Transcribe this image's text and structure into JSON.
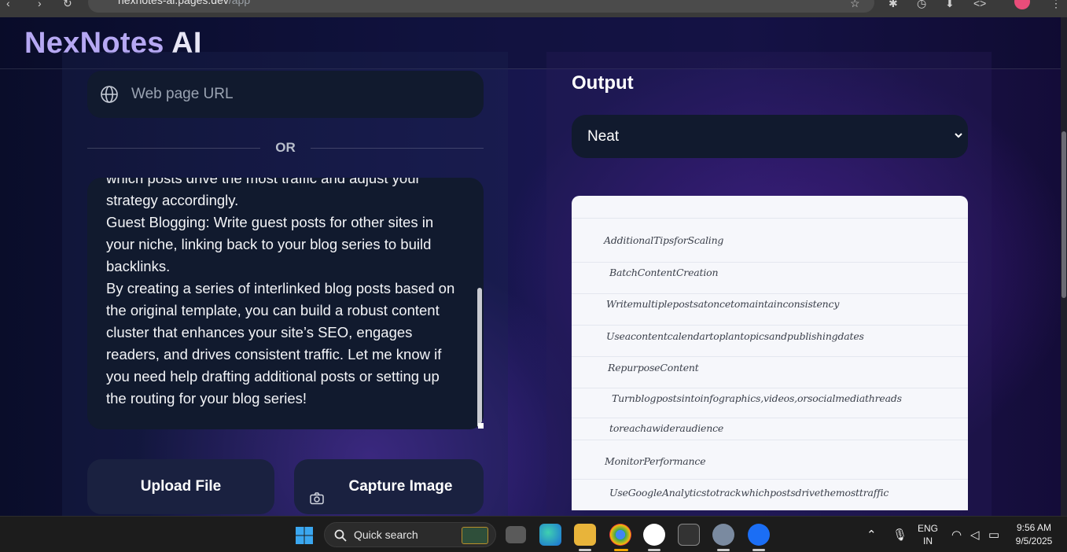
{
  "browser": {
    "url_host": "nexnotes-ai.pages.dev",
    "url_path": "/app"
  },
  "header": {
    "brand_part1": "NexNotes",
    "brand_part2": "AI"
  },
  "input": {
    "url_placeholder": "Web page URL",
    "or_label": "OR",
    "text_content": "which posts drive the most traffic and adjust your\nstrategy accordingly.\nGuest Blogging: Write guest posts for other sites in your niche, linking back to your blog series to build backlinks.\nBy creating a series of interlinked blog posts based on the original template, you can build a robust content cluster that enhances your site’s SEO, engages readers, and drives consistent traffic. Let me know if you need help drafting additional posts or setting up the routing for your blog series!",
    "upload_label": "Upload File",
    "capture_label": "Capture Image"
  },
  "output": {
    "title": "Output",
    "format_selected": "Neat",
    "lines": [
      "AdditionalTipsforScaling",
      "BatchContentCreation",
      "Writemultiplepostsatoncetomaintainconsistency",
      "Useacontentcalendartoplantopicsandpublishingdates",
      "RepurposeContent",
      "Turnblogpostsintoinfographics,videos,orsocialmediathreads",
      "toreachawideraudience",
      "MonitorPerformance",
      "UseGoogleAnalyticstotrackwhichpostsdrivethemosttraffic"
    ]
  },
  "taskbar": {
    "search_label": "Quick search",
    "lang_line1": "ENG",
    "lang_line2": "IN",
    "time": "9:56 AM",
    "date": "9/5/2025"
  },
  "colors": {
    "brand_accent": "#b6a8f3",
    "panel_dark": "#111a2e",
    "paper": "#f6f7fb"
  }
}
